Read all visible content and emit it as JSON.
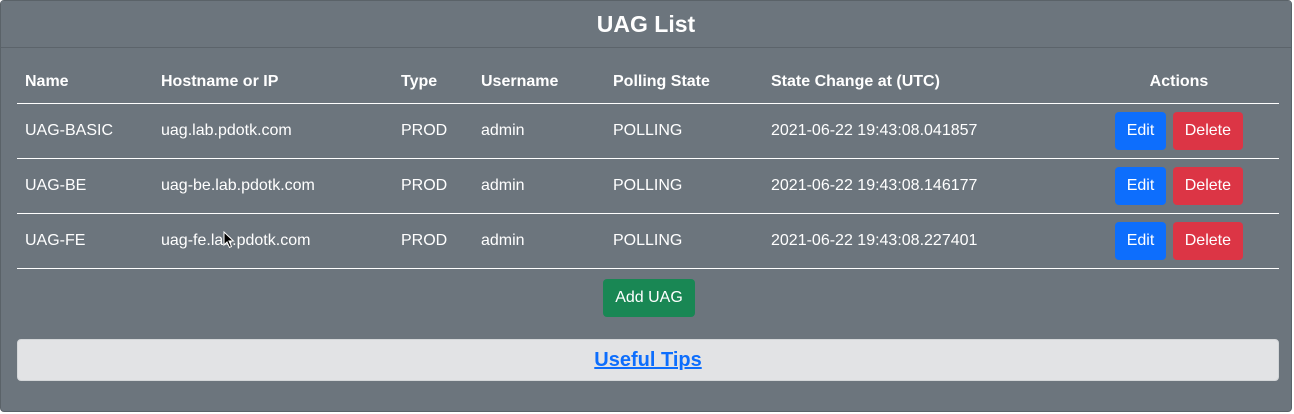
{
  "page": {
    "title": "UAG List"
  },
  "table": {
    "columns": {
      "name": "Name",
      "host": "Hostname or IP",
      "type": "Type",
      "username": "Username",
      "polling_state": "Polling State",
      "state_change": "State Change at (UTC)",
      "actions": "Actions"
    },
    "rows": [
      {
        "name": "UAG-BASIC",
        "host": "uag.lab.pdotk.com",
        "type": "PROD",
        "username": "admin",
        "polling_state": "POLLING",
        "state_change": "2021-06-22 19:43:08.041857",
        "edit_label": "Edit",
        "delete_label": "Delete"
      },
      {
        "name": "UAG-BE",
        "host": "uag-be.lab.pdotk.com",
        "type": "PROD",
        "username": "admin",
        "polling_state": "POLLING",
        "state_change": "2021-06-22 19:43:08.146177",
        "edit_label": "Edit",
        "delete_label": "Delete"
      },
      {
        "name": "UAG-FE",
        "host": "uag-fe.lab.pdotk.com",
        "type": "PROD",
        "username": "admin",
        "polling_state": "POLLING",
        "state_change": "2021-06-22 19:43:08.227401",
        "edit_label": "Edit",
        "delete_label": "Delete"
      }
    ]
  },
  "add_button": {
    "label": "Add UAG"
  },
  "tips": {
    "label": "Useful Tips"
  },
  "colors": {
    "card_bg": "#6c757d",
    "edit": "#0d6efd",
    "delete": "#dc3545",
    "add": "#198754",
    "tips_bg": "#e2e3e5",
    "link": "#0d6efd"
  },
  "icons": {
    "cursor": "mouse-pointer-icon"
  }
}
